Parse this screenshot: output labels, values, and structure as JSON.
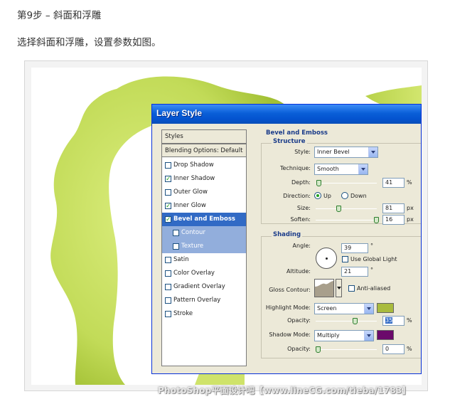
{
  "page": {
    "step_title": "第9步 – 斜面和浮雕",
    "instruction": "选择斜面和浮雕，设置参数如图。",
    "watermark": "PhotoShop平面设计吧【www.lineCG.com/tieba/1783】"
  },
  "dialog": {
    "title": "Layer Style",
    "styles_list": {
      "header": "Styles",
      "blending": "Blending Options: Default",
      "items": [
        {
          "label": "Drop Shadow",
          "checked": false
        },
        {
          "label": "Inner Shadow",
          "checked": true
        },
        {
          "label": "Outer Glow",
          "checked": false
        },
        {
          "label": "Inner Glow",
          "checked": true
        },
        {
          "label": "Bevel and Emboss",
          "checked": true,
          "selected": true
        },
        {
          "label": "Contour",
          "checked": false,
          "sub": true
        },
        {
          "label": "Texture",
          "checked": false,
          "sub": true
        },
        {
          "label": "Satin",
          "checked": false
        },
        {
          "label": "Color Overlay",
          "checked": false
        },
        {
          "label": "Gradient Overlay",
          "checked": false
        },
        {
          "label": "Pattern Overlay",
          "checked": false
        },
        {
          "label": "Stroke",
          "checked": false
        }
      ]
    },
    "bevel": {
      "section_title": "Bevel and Emboss",
      "structure_title": "Structure",
      "style_label": "Style:",
      "style_value": "Inner Bevel",
      "technique_label": "Technique:",
      "technique_value": "Smooth",
      "depth_label": "Depth:",
      "depth_value": "41",
      "depth_unit": "%",
      "direction_label": "Direction:",
      "direction_up": "Up",
      "direction_down": "Down",
      "size_label": "Size:",
      "size_value": "81",
      "size_unit": "px",
      "soften_label": "Soften:",
      "soften_value": "16",
      "soften_unit": "px"
    },
    "shading": {
      "title": "Shading",
      "angle_label": "Angle:",
      "angle_value": "39",
      "angle_unit": "°",
      "global_light_label": "Use Global Light",
      "altitude_label": "Altitude:",
      "altitude_value": "21",
      "altitude_unit": "°",
      "gloss_label": "Gloss Contour:",
      "anti_aliased_label": "Anti-aliased",
      "highlight_mode_label": "Highlight Mode:",
      "highlight_mode_value": "Screen",
      "highlight_color": "#a9bb3d",
      "highlight_opacity_label": "Opacity:",
      "highlight_opacity_value": "35",
      "highlight_opacity_unit": "%",
      "shadow_mode_label": "Shadow Mode:",
      "shadow_mode_value": "Multiply",
      "shadow_color": "#6b0a6b",
      "shadow_opacity_label": "Opacity:",
      "shadow_opacity_value": "0",
      "shadow_opacity_unit": "%"
    }
  },
  "colors": {
    "shape_light": "#d8ea7a",
    "shape_dark": "#a6c33a",
    "dialog_bg": "#ece9d8",
    "title_bar": "#0a5fd8"
  }
}
